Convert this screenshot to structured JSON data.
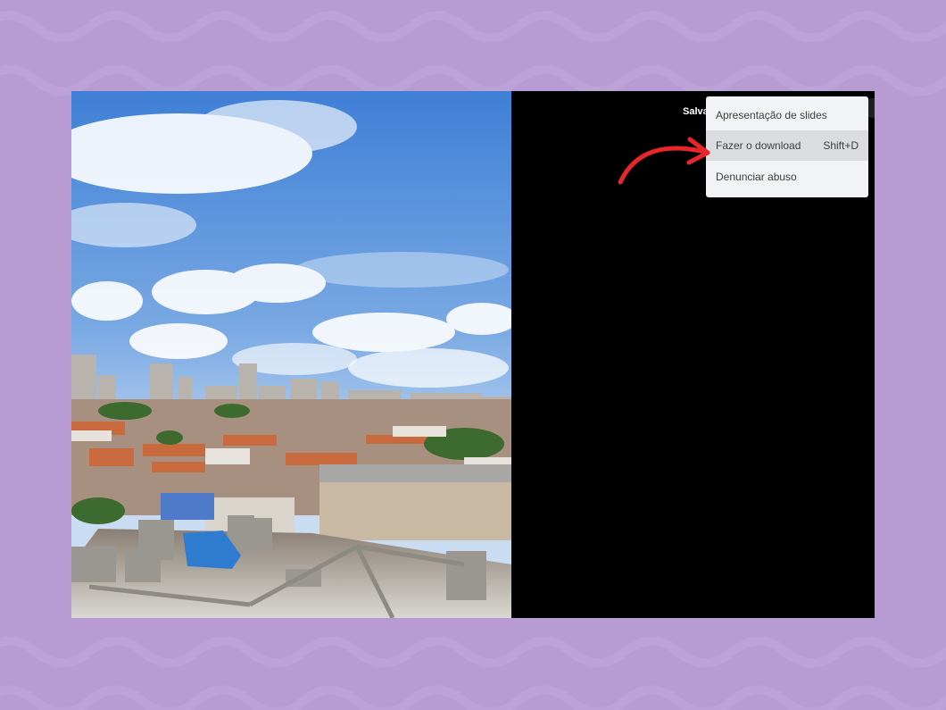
{
  "viewer": {
    "top_label": "Salvar"
  },
  "menu": {
    "items": [
      {
        "label": "Apresentação de slides",
        "shortcut": ""
      },
      {
        "label": "Fazer o download",
        "shortcut": "Shift+D"
      },
      {
        "label": "Denunciar abuso",
        "shortcut": ""
      }
    ],
    "highlighted_index": 1
  },
  "colors": {
    "background": "#b89bd3",
    "frame": "#000000",
    "menu": "#f1f3f4",
    "menu_highlight": "#dadce0",
    "annotation_arrow": "#e8262a"
  },
  "icons": {
    "annotation": "curved-arrow-icon"
  }
}
